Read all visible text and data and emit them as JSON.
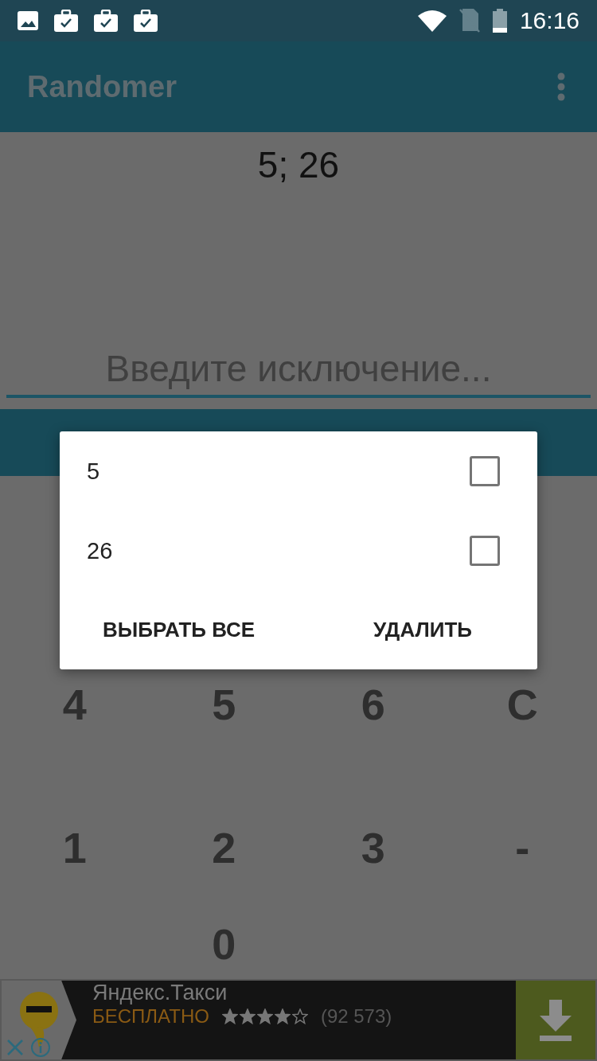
{
  "status_bar": {
    "time": "16:16"
  },
  "app_bar": {
    "title": "Randomer"
  },
  "result": "5; 26",
  "exclusion_field": {
    "placeholder": "Введите исключение..."
  },
  "keypad": [
    [
      "4",
      "5",
      "6",
      "C"
    ],
    [
      "1",
      "2",
      "3",
      "-"
    ]
  ],
  "zero_key": "0",
  "dialog": {
    "items": [
      {
        "label": "5",
        "checked": false
      },
      {
        "label": "26",
        "checked": false
      }
    ],
    "buttons": [
      "ВЫБРАТЬ ВСЕ",
      "УДАЛИТЬ"
    ]
  },
  "ad": {
    "title": "Яндекс.Такси",
    "price": "БЕСПЛАТНО",
    "stars": 4,
    "reviews": "(92 573)"
  }
}
